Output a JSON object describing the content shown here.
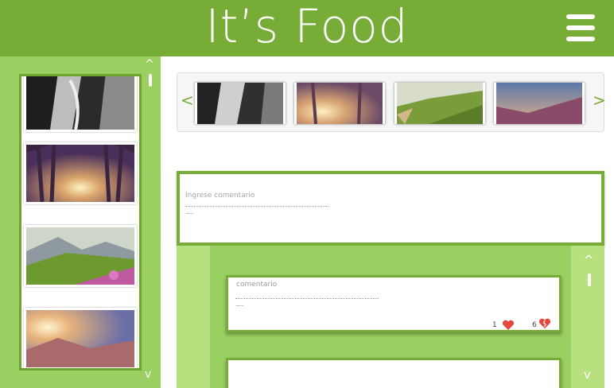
{
  "header": {
    "title": "It’s Food",
    "menu_icon": "hamburger-menu-icon",
    "background": "#77ad36"
  },
  "sidebar": {
    "scroll_up": "^",
    "scroll_down": "v",
    "images": [
      "black-white-canyon",
      "sunlit-forest",
      "flowering-mountain-meadow",
      "mountain-sunset"
    ]
  },
  "carousel": {
    "prev": "<",
    "next": ">",
    "images": [
      "black-white-canyon",
      "sunlit-forest",
      "green-hillside",
      "sunset-valley"
    ]
  },
  "comment_input": {
    "placeholder": "Ingrese comentario",
    "dots": "........"
  },
  "comments": {
    "scroll_up": "^",
    "scroll_down": "v",
    "items": [
      {
        "label": "comentario",
        "dots": "........",
        "likes": "1",
        "dislikes": "6"
      },
      {
        "label": "",
        "dots": "",
        "likes": "",
        "dislikes": ""
      }
    ]
  },
  "colors": {
    "accent": "#77ad36",
    "light_green": "#9acf62",
    "pale_green": "#b7e07f",
    "heart": "#e6473b"
  }
}
